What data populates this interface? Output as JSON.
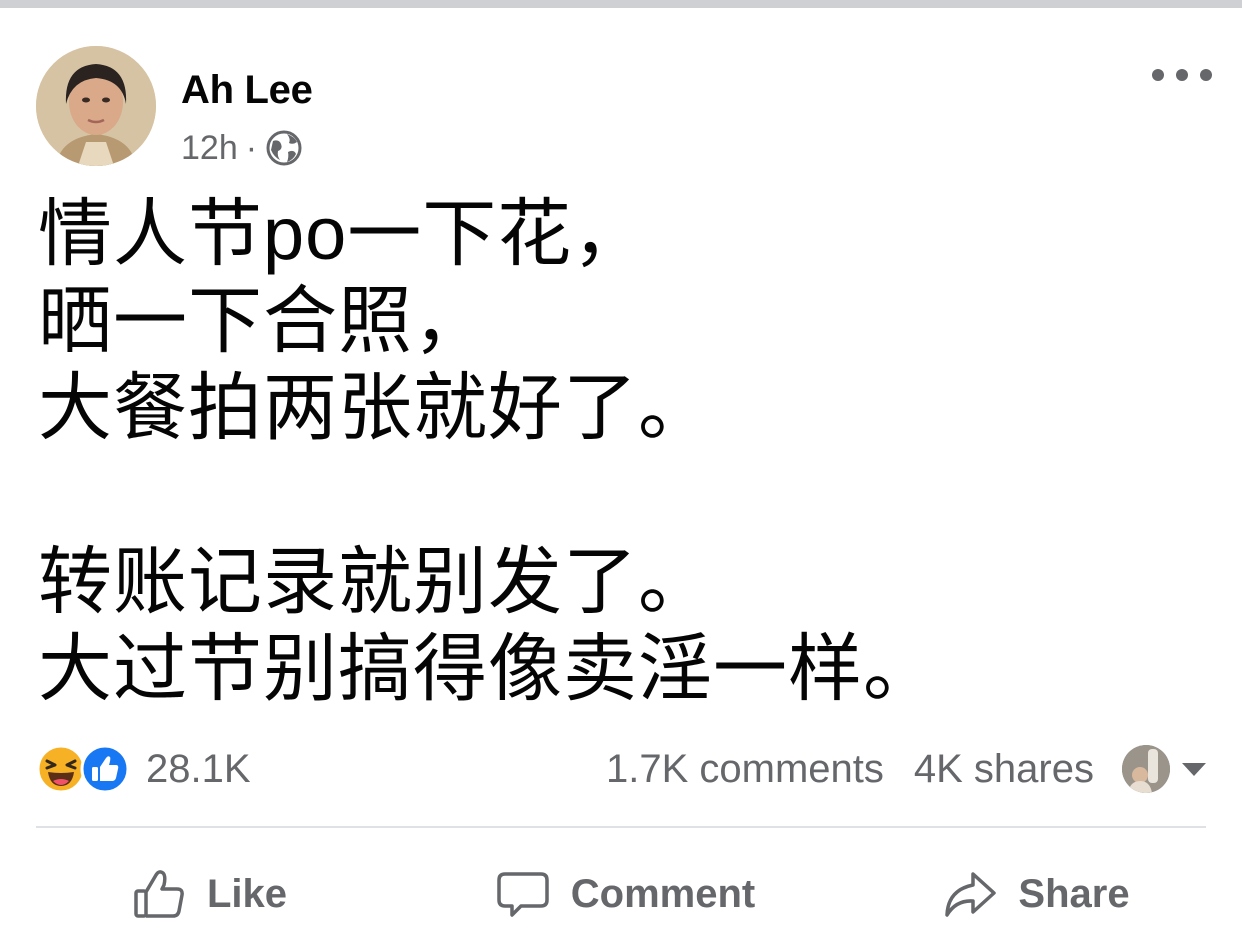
{
  "post": {
    "author": "Ah Lee",
    "time": "12h",
    "separator": "·",
    "privacy_icon": "globe-icon",
    "more_icon": "more-options-icon",
    "text": "情人节po一下花，\n晒一下合照，\n大餐拍两张就好了。\n\n转账记录就别发了。\n大过节别搞得像卖淫一样。"
  },
  "reactions": {
    "icons": [
      "haha-icon",
      "like-icon"
    ],
    "count": "28.1K"
  },
  "stats": {
    "comments": "1.7K comments",
    "shares": "4K shares"
  },
  "actions": {
    "like": "Like",
    "comment": "Comment",
    "share": "Share"
  },
  "colors": {
    "text": "#050505",
    "secondary": "#65676b",
    "like_blue": "#1877f2",
    "haha_yellow": "#f7b125",
    "divider": "#dfe1e4"
  }
}
